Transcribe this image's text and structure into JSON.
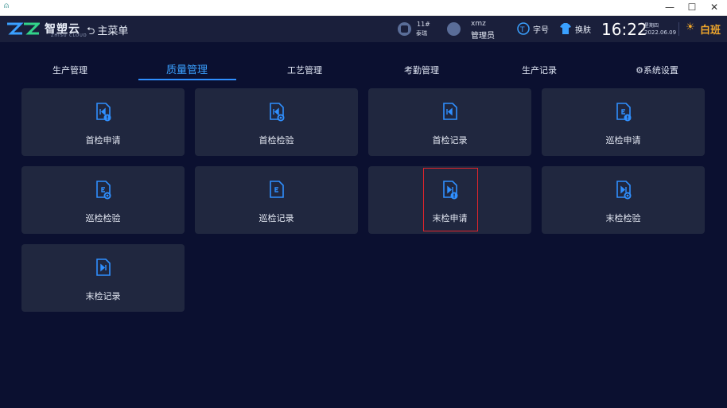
{
  "window": {
    "minimize_glyph": "—",
    "maximize_glyph": "☐",
    "close_glyph": "✕",
    "app_icon_glyph": "⍝"
  },
  "header": {
    "logo_text": "智塑云",
    "logo_sub": "ZHISU CLOUD",
    "main_menu_glyph": "⮌",
    "main_menu": "主菜单",
    "machine_number": "11#",
    "machine_label": "泰瑞",
    "user_name": "xmz",
    "user_role": "管理员",
    "font_size_label": "字号",
    "skin_label": "换肤",
    "time": "16:22",
    "weekday": "星期四",
    "date": "2022.06.09",
    "shift_glyph": "☀",
    "shift": "白班"
  },
  "tabs": [
    {
      "label": "生产管理"
    },
    {
      "label": "质量管理"
    },
    {
      "label": "工艺管理"
    },
    {
      "label": "考勤管理"
    },
    {
      "label": "生产记录"
    },
    {
      "label": "⚙系统设置"
    }
  ],
  "cards": [
    {
      "label": "首检申请",
      "icon": "first-inspection-apply-icon"
    },
    {
      "label": "首检检验",
      "icon": "first-inspection-check-icon"
    },
    {
      "label": "首检记录",
      "icon": "first-inspection-record-icon"
    },
    {
      "label": "巡检申请",
      "icon": "patrol-inspection-apply-icon"
    },
    {
      "label": "巡检检验",
      "icon": "patrol-inspection-check-icon"
    },
    {
      "label": "巡检记录",
      "icon": "patrol-inspection-record-icon"
    },
    {
      "label": "末检申请",
      "icon": "final-inspection-apply-icon"
    },
    {
      "label": "末检检验",
      "icon": "final-inspection-check-icon"
    },
    {
      "label": "末检记录",
      "icon": "final-inspection-record-icon"
    }
  ],
  "colors": {
    "accent": "#2f8fff",
    "background": "#0b1030",
    "card": "#20273f",
    "shift": "#f3a92b",
    "highlight": "#e0242c"
  }
}
